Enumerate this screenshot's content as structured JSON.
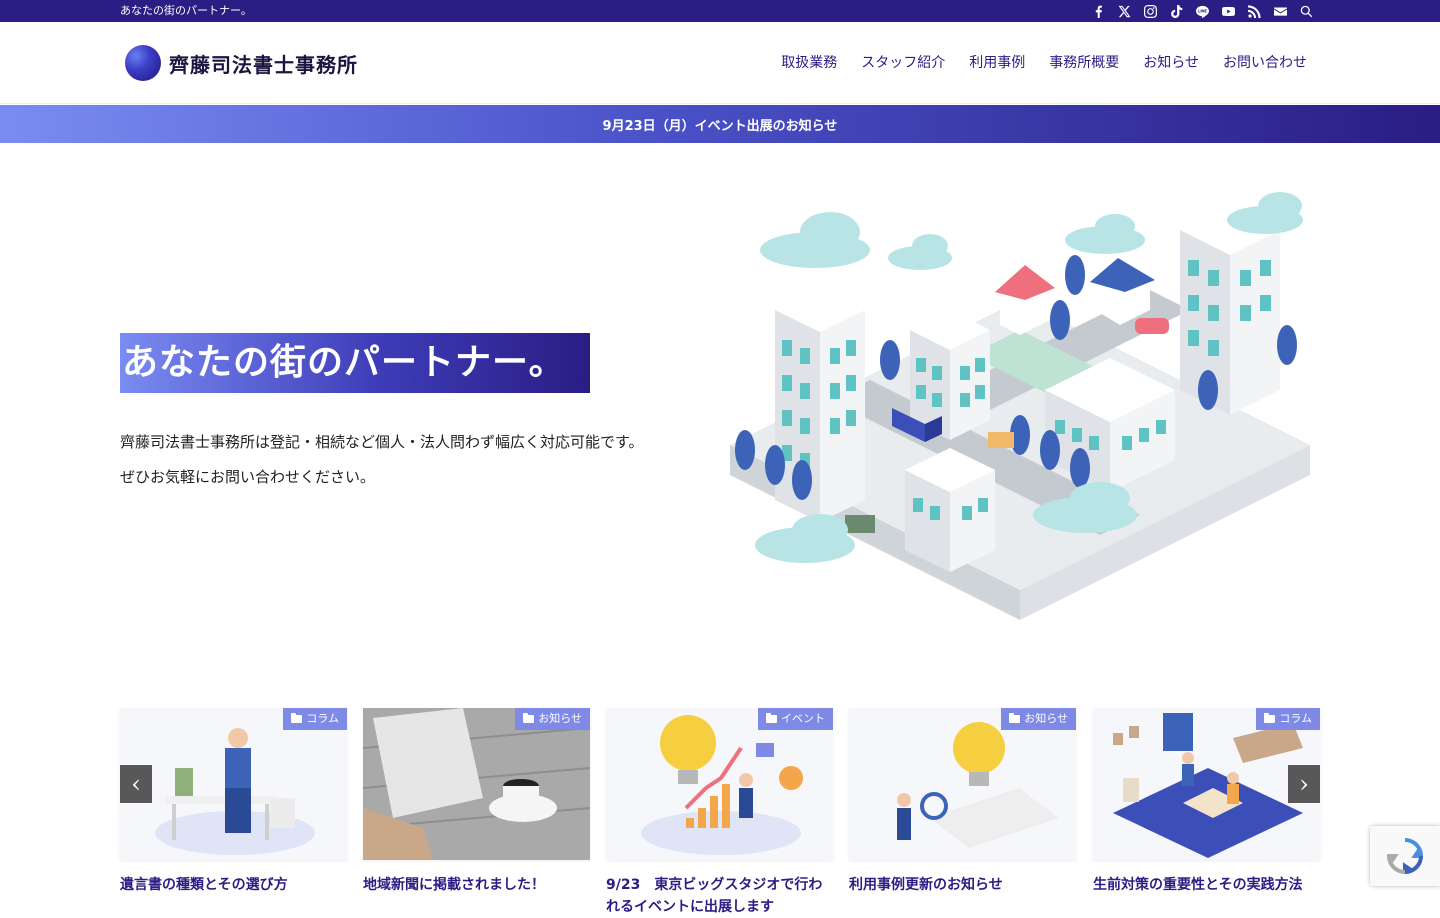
{
  "topbar": {
    "tagline": "あなたの街のパートナー。",
    "icons": [
      "facebook-icon",
      "x-icon",
      "instagram-icon",
      "tiktok-icon",
      "line-icon",
      "youtube-icon",
      "rss-icon",
      "mail-icon",
      "search-icon"
    ]
  },
  "header": {
    "site_name": "齊藤司法書士事務所",
    "nav": [
      "取扱業務",
      "スタッフ紹介",
      "利用事例",
      "事務所概要",
      "お知らせ",
      "お問い合わせ"
    ]
  },
  "notice": {
    "text": "9月23日（月）イベント出展のお知らせ"
  },
  "hero": {
    "title": "あなたの街のパートナー。",
    "desc_line1": "齊藤司法書士事務所は登記・相続など個人・法人問わず幅広く対応可能です。",
    "desc_line2": "ぜひお気軽にお問い合わせください。"
  },
  "cards": [
    {
      "category": "コラム",
      "title": "遺言書の種類とその選び方"
    },
    {
      "category": "お知らせ",
      "title": "地域新聞に掲載されました！"
    },
    {
      "category": "イベント",
      "title": "9/23　東京ビッグスタジオで行われるイベントに出展します"
    },
    {
      "category": "お知らせ",
      "title": "利用事例更新のお知らせ"
    },
    {
      "category": "コラム",
      "title": "生前対策の重要性とその実践方法"
    }
  ],
  "slider": {
    "prev_label": "‹",
    "next_label": "›"
  },
  "colors": {
    "brand": "#2a1d84",
    "accent": "#7e8ae6",
    "building": "#5fc3c3"
  }
}
